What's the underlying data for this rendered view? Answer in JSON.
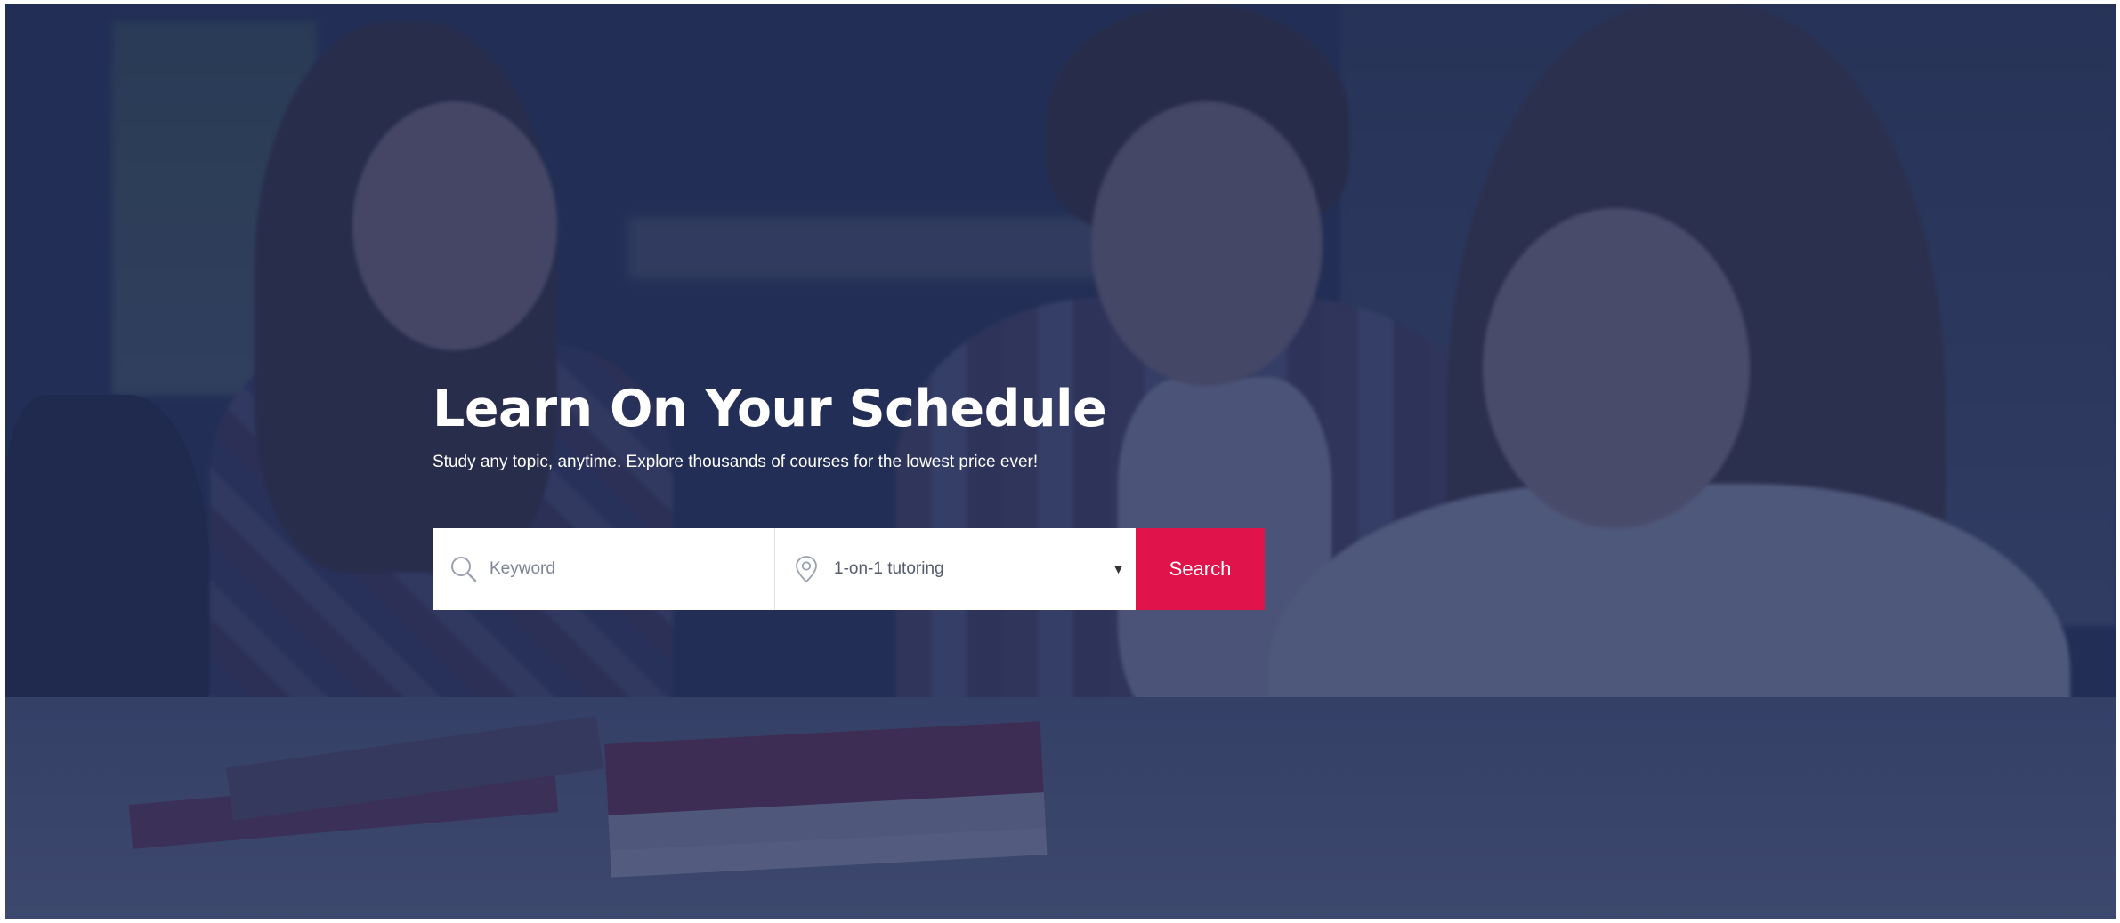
{
  "hero": {
    "title": "Learn On Your Schedule",
    "subtitle": "Study any topic, anytime. Explore thousands of courses for the lowest price ever!"
  },
  "search": {
    "keyword_placeholder": "Keyword",
    "keyword_icon": "search-icon",
    "type_icon": "location-pin-icon",
    "type_selected": "1-on-1 tutoring",
    "caret": "▼",
    "button_label": "Search"
  },
  "colors": {
    "accent": "#e0134a",
    "overlay": "#202d58"
  }
}
